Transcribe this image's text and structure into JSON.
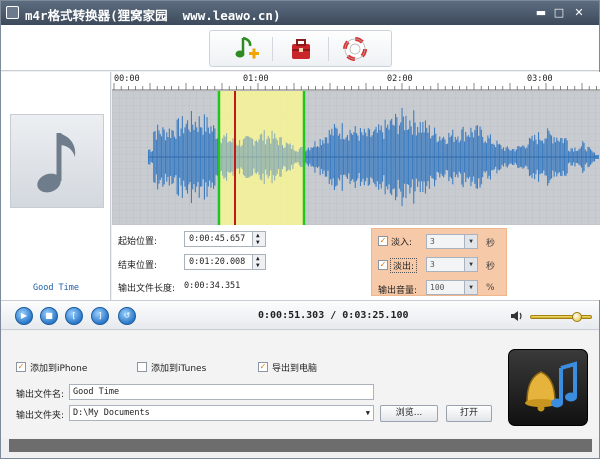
{
  "window": {
    "title": "m4r格式转换器(狸窝家园  www.leawo.cn)",
    "min": "▬",
    "max": "□",
    "close": "✕"
  },
  "toolbar": {
    "items": [
      "add-file",
      "toolbox",
      "help"
    ]
  },
  "track": {
    "name": "Good Time"
  },
  "timeline": {
    "ticks": [
      "00:00",
      "01:00",
      "02:00",
      "03:00"
    ]
  },
  "positions": {
    "start_label": "起始位置:",
    "start_value": "0:00:45.657",
    "end_label": "结束位置:",
    "end_value": "0:01:20.008",
    "length_label": "输出文件长度:",
    "length_value": "0:00:34.351"
  },
  "fade": {
    "fade_in_label": "淡入:",
    "fade_in_value": "3",
    "fade_in_unit": "秒",
    "fade_out_label": "淡出:",
    "fade_out_value": "3",
    "fade_out_unit": "秒",
    "volume_label": "输出音量:",
    "volume_value": "100",
    "volume_unit": "%"
  },
  "transport": {
    "time": "0:00:51.303 / 0:03:25.100",
    "volume_level": 0.82
  },
  "options": {
    "add_iphone": "添加到iPhone",
    "add_itunes": "添加到iTunes",
    "export_pc": "导出到电脑"
  },
  "output": {
    "filename_label": "输出文件名:",
    "filename_value": "Good Time",
    "folder_label": "输出文件夹:",
    "folder_value": "D:\\My Documents",
    "browse": "浏览...",
    "open": "打开"
  },
  "colors": {
    "accent": "#2a78c8",
    "selection": "#f3f29a",
    "fade": "#f6c9a8",
    "wave": "#3f7dc1"
  }
}
